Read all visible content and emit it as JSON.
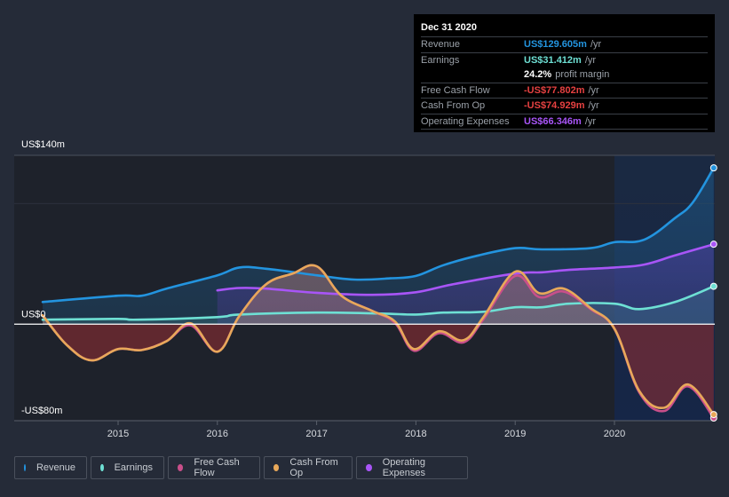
{
  "tooltip": {
    "date": "Dec 31 2020",
    "rows": [
      {
        "label": "Revenue",
        "value": "US$129.605m",
        "unit": "/yr",
        "color": "#2394df"
      },
      {
        "label": "Earnings",
        "value": "US$31.412m",
        "unit": "/yr",
        "color": "#6ee0d4"
      },
      {
        "label": "",
        "value": "24.2%",
        "unit": "profit margin",
        "color": "#ffffff"
      },
      {
        "label": "Free Cash Flow",
        "value": "-US$77.802m",
        "unit": "/yr",
        "color": "#e64141"
      },
      {
        "label": "Cash From Op",
        "value": "-US$74.929m",
        "unit": "/yr",
        "color": "#e64141"
      },
      {
        "label": "Operating Expenses",
        "value": "US$66.346m",
        "unit": "/yr",
        "color": "#a855f7"
      }
    ]
  },
  "legend": [
    {
      "label": "Revenue",
      "color": "#2394df"
    },
    {
      "label": "Earnings",
      "color": "#6ee0d4"
    },
    {
      "label": "Free Cash Flow",
      "color": "#c94f8a"
    },
    {
      "label": "Cash From Op",
      "color": "#e8a85a"
    },
    {
      "label": "Operating Expenses",
      "color": "#a855f7"
    }
  ],
  "chart_data": {
    "type": "area",
    "title": "",
    "xlabel": "",
    "ylabel": "",
    "ylim": [
      -80,
      140
    ],
    "y_tick_labels": [
      "US$140m",
      "US$0",
      "-US$80m"
    ],
    "y_ticks": [
      140,
      0,
      -80
    ],
    "x_ticks": [
      2015,
      2016,
      2017,
      2018,
      2019,
      2020
    ],
    "x_tick_labels": [
      "2015",
      "2016",
      "2017",
      "2018",
      "2019",
      "2020"
    ],
    "xlim": [
      2013.87,
      2021.0
    ],
    "highlight_from": 2020.0,
    "grid": true,
    "legend_position": "bottom",
    "series": [
      {
        "name": "Revenue",
        "color": "#2394df",
        "x": [
          2014.24,
          2015.0,
          2015.24,
          2015.51,
          2016.0,
          2016.22,
          2016.49,
          2017.0,
          2017.38,
          2017.74,
          2018.0,
          2018.28,
          2018.63,
          2019.0,
          2019.27,
          2019.76,
          2020.0,
          2020.3,
          2020.61,
          2020.79,
          2021.0
        ],
        "values": [
          18.4,
          23.6,
          23.6,
          30,
          40.5,
          47,
          46,
          40.5,
          37,
          38,
          40,
          49,
          57,
          63,
          62,
          63,
          68,
          70,
          88,
          101,
          129.6
        ]
      },
      {
        "name": "Earnings",
        "color": "#6ee0d4",
        "x": [
          2014.24,
          2015.0,
          2015.2,
          2016.0,
          2016.22,
          2017.0,
          2017.65,
          2018.0,
          2018.28,
          2018.68,
          2019.0,
          2019.27,
          2019.54,
          2020.0,
          2020.25,
          2020.61,
          2021.0
        ],
        "values": [
          3.7,
          4.4,
          3.7,
          5.9,
          8,
          9.6,
          8.8,
          8,
          9.6,
          10.3,
          14,
          14,
          17,
          17,
          12.5,
          18.4,
          31.4
        ]
      },
      {
        "name": "Free Cash Flow",
        "color": "#c94f8a",
        "x": [
          2014.24,
          2014.48,
          2014.73,
          2015.0,
          2015.24,
          2015.49,
          2015.73,
          2016.0,
          2016.22,
          2016.49,
          2016.76,
          2017.0,
          2017.25,
          2017.56,
          2017.79,
          2017.98,
          2018.23,
          2018.48,
          2018.68,
          2019.0,
          2019.24,
          2019.49,
          2019.76,
          2020.0,
          2020.25,
          2020.5,
          2020.74,
          2021.0
        ],
        "values": [
          7.4,
          -17,
          -30,
          -20.6,
          -21.4,
          -14,
          -1,
          -22.8,
          6.6,
          33,
          42,
          48,
          23.6,
          11,
          1,
          -22,
          -7.5,
          -15,
          4,
          40,
          22.5,
          27,
          12.5,
          -4,
          -56.5,
          -72,
          -51.5,
          -77.8
        ]
      },
      {
        "name": "Cash From Op",
        "color": "#e8a85a",
        "x": [
          2014.24,
          2014.48,
          2014.73,
          2015.0,
          2015.24,
          2015.49,
          2015.73,
          2016.0,
          2016.22,
          2016.49,
          2016.76,
          2017.0,
          2017.25,
          2017.56,
          2017.79,
          2017.98,
          2018.23,
          2018.48,
          2018.68,
          2019.0,
          2019.24,
          2019.49,
          2019.76,
          2020.0,
          2020.25,
          2020.5,
          2020.74,
          2021.0
        ],
        "values": [
          7.4,
          -17,
          -30,
          -20.6,
          -21.4,
          -14,
          0.7,
          -22.8,
          6.6,
          33,
          42,
          48,
          23.6,
          11,
          2.2,
          -20.6,
          -5.9,
          -13.3,
          5.9,
          43.5,
          25.8,
          29.5,
          13.3,
          -3.7,
          -55.3,
          -69.3,
          -50,
          -74.9
        ]
      },
      {
        "name": "Operating Expenses",
        "color": "#a855f7",
        "x": [
          2016.0,
          2016.22,
          2016.49,
          2017.0,
          2017.56,
          2018.0,
          2018.37,
          2019.0,
          2019.27,
          2019.54,
          2020.0,
          2020.3,
          2020.61,
          2021.0
        ],
        "values": [
          28,
          30,
          29.5,
          26,
          24.3,
          26.5,
          33,
          42,
          43,
          45,
          47,
          49.4,
          57,
          66.3
        ]
      }
    ]
  }
}
